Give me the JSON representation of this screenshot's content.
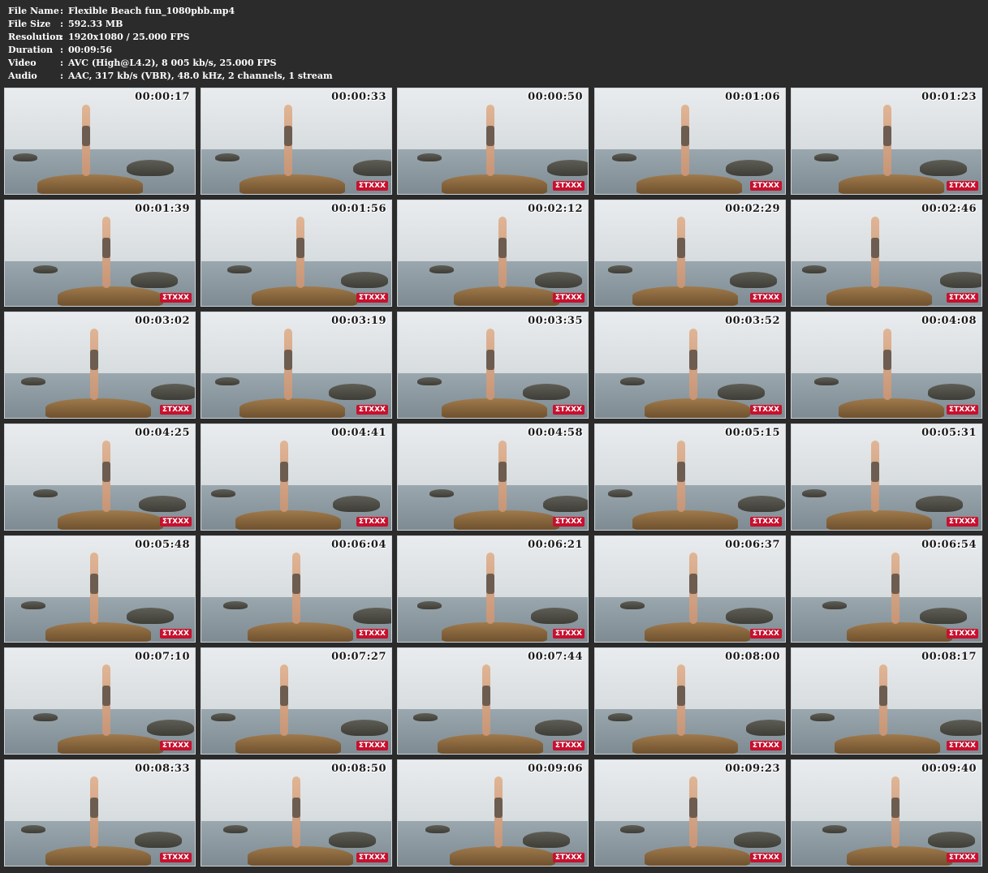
{
  "info": [
    {
      "label": "File Name",
      "value": "Flexible Beach fun_1080pbb.mp4"
    },
    {
      "label": "File Size",
      "value": "592.33 MB"
    },
    {
      "label": "Resolution",
      "value": "1920x1080 / 25.000 FPS"
    },
    {
      "label": "Duration",
      "value": "00:09:56"
    },
    {
      "label": "Video",
      "value": "AVC (High@L4.2), 8 005 kb/s, 25.000 FPS"
    },
    {
      "label": "Audio",
      "value": "AAC, 317 kb/s (VBR), 48.0 kHz, 2 channels, 1 stream"
    }
  ],
  "separator": ":",
  "logo_text": "ΣTXXX",
  "thumbnails": [
    "00:00:17",
    "00:00:33",
    "00:00:50",
    "00:01:06",
    "00:01:23",
    "00:01:39",
    "00:01:56",
    "00:02:12",
    "00:02:29",
    "00:02:46",
    "00:03:02",
    "00:03:19",
    "00:03:35",
    "00:03:52",
    "00:04:08",
    "00:04:25",
    "00:04:41",
    "00:04:58",
    "00:05:15",
    "00:05:31",
    "00:05:48",
    "00:06:04",
    "00:06:21",
    "00:06:37",
    "00:06:54",
    "00:07:10",
    "00:07:27",
    "00:07:44",
    "00:08:00",
    "00:08:17",
    "00:08:33",
    "00:08:50",
    "00:09:06",
    "00:09:23",
    "00:09:40"
  ],
  "colors": {
    "background": "#2b2b2b",
    "text": "#ffffff",
    "timestamp": "#1a1a1a",
    "logo": "#c8102e"
  }
}
